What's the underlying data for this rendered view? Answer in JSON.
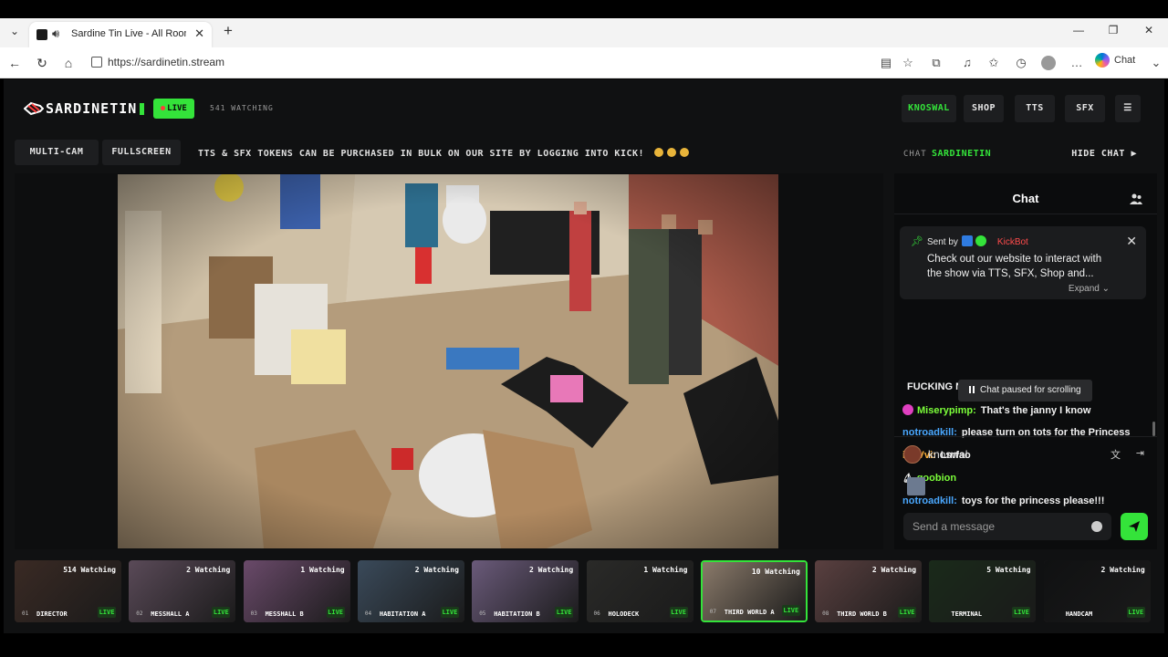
{
  "browser": {
    "tab_title": "Sardine Tin Live - All Rooms, /",
    "url": "https://sardinetin.stream",
    "chat_label": "Chat"
  },
  "site": {
    "logo_text": "SARDINETIN",
    "live_label": "LIVE",
    "watching": "541 WATCHING",
    "nav": [
      {
        "label": "KNOSWAL",
        "active": true
      },
      {
        "label": "SHOP"
      },
      {
        "label": "TTS"
      },
      {
        "label": "SFX"
      }
    ],
    "buttons": {
      "multicam": "MULTI-CAM",
      "fullscreen": "FULLSCREEN"
    },
    "ticker": "TTS & SFX TOKENS CAN BE PURCHASED IN BULK ON OUR SITE BY LOGGING INTO KICK!",
    "accent": "#34e33a"
  },
  "chat": {
    "header_label": "CHAT",
    "room": "SARDINETIN",
    "hide_label": "HIDE CHAT ▶",
    "title": "Chat",
    "pinned": {
      "sent_by": "Sent by",
      "bot": "KickBot",
      "message": "Check out our website to interact with the show via TTS, SFX, Shop and...",
      "expand": "Expand"
    },
    "messages": [
      {
        "user": "",
        "text": "FUCKING NAME RIGHT",
        "color": "#f2f2f2"
      },
      {
        "user": "Miserypimp:",
        "text": "That's the janny I know",
        "color": "#7cff3a"
      },
      {
        "user": "notroadkill:",
        "text": "please turn on tots for the Princess",
        "color": "#4aa8ff"
      },
      {
        "user": "ixXVvi:",
        "text": "Lmfao",
        "color": "#ffb13b"
      },
      {
        "user": "goobion",
        "text": "",
        "color": "#7cff3a"
      },
      {
        "user": "notroadkill:",
        "text": "toys for the princess please!!!",
        "color": "#4aa8ff"
      }
    ],
    "paused": "Chat paused for scrolling",
    "current_user": "knoswal",
    "input_placeholder": "Send a message"
  },
  "thumbs": [
    {
      "num": "01",
      "name": "DIRECTOR",
      "watching": "514 Watching",
      "live": "LIVE"
    },
    {
      "num": "02",
      "name": "MESSHALL A",
      "watching": "2 Watching",
      "live": "LIVE"
    },
    {
      "num": "03",
      "name": "MESSHALL B",
      "watching": "1 Watching",
      "live": "LIVE"
    },
    {
      "num": "04",
      "name": "HABITATION A",
      "watching": "2 Watching",
      "live": "LIVE"
    },
    {
      "num": "05",
      "name": "HABITATION B",
      "watching": "2 Watching",
      "live": "LIVE"
    },
    {
      "num": "06",
      "name": "HOLODECK",
      "watching": "1 Watching",
      "live": "LIVE"
    },
    {
      "num": "07",
      "name": "THIRD WORLD A",
      "watching": "10 Watching",
      "live": "LIVE",
      "active": true
    },
    {
      "num": "08",
      "name": "THIRD WORLD B",
      "watching": "2 Watching",
      "live": "LIVE"
    },
    {
      "num": "",
      "name": "TERMINAL",
      "watching": "5 Watching",
      "live": "LIVE"
    },
    {
      "num": "",
      "name": "HANDCAM",
      "watching": "2 Watching",
      "live": "LIVE"
    }
  ]
}
